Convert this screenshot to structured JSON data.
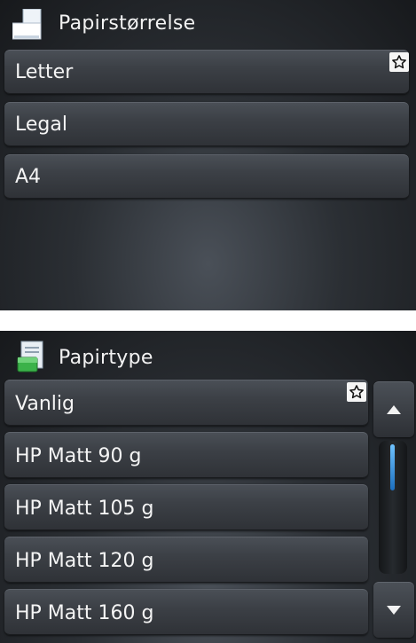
{
  "paper_size": {
    "title": "Papirstørrelse",
    "title_icon": "paper-size-icon",
    "items": [
      {
        "label": "Letter",
        "favorite": true
      },
      {
        "label": "Legal",
        "favorite": false
      },
      {
        "label": "A4",
        "favorite": false
      }
    ]
  },
  "paper_type": {
    "title": "Papirtype",
    "title_icon": "paper-type-icon",
    "items": [
      {
        "label": "Vanlig",
        "favorite": true
      },
      {
        "label": "HP Matt 90 g",
        "favorite": false
      },
      {
        "label": "HP Matt 105 g",
        "favorite": false
      },
      {
        "label": "HP Matt 120 g",
        "favorite": false
      },
      {
        "label": "HP Matt 160 g",
        "favorite": false
      }
    ],
    "scroll_up_icon": "triangle-up-icon",
    "scroll_down_icon": "triangle-down-icon"
  },
  "colors": {
    "accent_scroll": "#3a9cf0",
    "favorite_bg": "#f5f5f5"
  }
}
